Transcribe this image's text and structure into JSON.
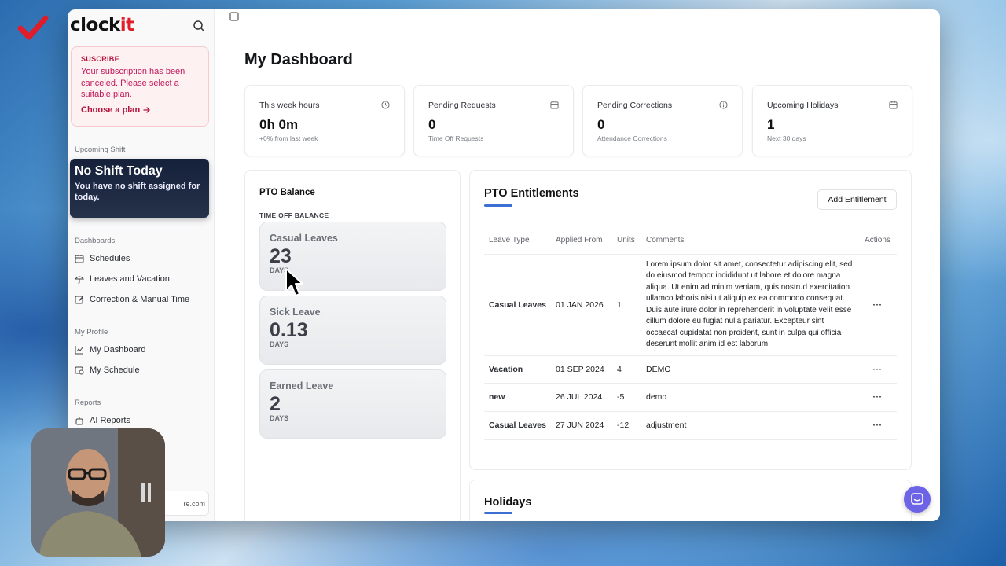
{
  "sidebar": {
    "logo_prefix": "clock",
    "logo_suffix": "it",
    "subscription": {
      "title": "SUSCRIBE",
      "message": "Your subscription has been canceled. Please select a suitable plan.",
      "link": "Choose a plan"
    },
    "upcoming_shift_label": "Upcoming Shift",
    "shift_title": "No Shift Today",
    "shift_message": "You have no shift assigned for today.",
    "section_dashboards": "Dashboards",
    "dashboards": [
      "Schedules",
      "Leaves and Vacation",
      "Correction & Manual Time"
    ],
    "section_profile": "My Profile",
    "profile": [
      "My Dashboard",
      "My Schedule"
    ],
    "section_reports": "Reports",
    "reports": [
      "AI Reports"
    ],
    "email_fragment": "re.com"
  },
  "main": {
    "title": "My Dashboard",
    "stats": [
      {
        "label": "This week hours",
        "value": "0h 0m",
        "sub": "+0% from last week",
        "icon": "clock-icon"
      },
      {
        "label": "Pending Requests",
        "value": "0",
        "sub": "Time Off Requests",
        "icon": "calendar-icon"
      },
      {
        "label": "Pending Corrections",
        "value": "0",
        "sub": "Attendance Corrections",
        "icon": "info-icon"
      },
      {
        "label": "Upcoming Holidays",
        "value": "1",
        "sub": "Next 30 days",
        "icon": "calendar-icon"
      }
    ],
    "pto": {
      "title": "PTO Balance",
      "subtitle": "TIME OFF BALANCE",
      "leaves": [
        {
          "name": "Casual Leaves",
          "value": "23",
          "unit": "DAYS"
        },
        {
          "name": "Sick Leave",
          "value": "0.13",
          "unit": "DAYS"
        },
        {
          "name": "Earned Leave",
          "value": "2",
          "unit": "DAYS"
        }
      ]
    },
    "entitlements": {
      "title": "PTO Entitlements",
      "add_button": "Add Entitlement",
      "columns": [
        "Leave Type",
        "Applied From",
        "Units",
        "Comments",
        "Actions"
      ],
      "rows": [
        {
          "type": "Casual Leaves",
          "from": "01 JAN 2026",
          "units": "1",
          "comments": "Lorem ipsum dolor sit amet, consectetur adipiscing elit, sed do eiusmod tempor incididunt ut labore et dolore magna aliqua. Ut enim ad minim veniam, quis nostrud exercitation ullamco laboris nisi ut aliquip ex ea commodo consequat. Duis aute irure dolor in reprehenderit in voluptate velit esse cillum dolore eu fugiat nulla pariatur. Excepteur sint occaecat cupidatat non proident, sunt in culpa qui officia deserunt mollit anim id est laborum.",
          "action": "···"
        },
        {
          "type": "Vacation",
          "from": "01 SEP 2024",
          "units": "4",
          "comments": "DEMO",
          "action": "···"
        },
        {
          "type": "new",
          "from": "26 JUL 2024",
          "units": "-5",
          "comments": "demo",
          "action": "···"
        },
        {
          "type": "Casual Leaves",
          "from": "27 JUN 2024",
          "units": "-12",
          "comments": "adjustment",
          "action": "···"
        }
      ]
    },
    "holidays_title": "Holidays"
  },
  "colors": {
    "accent": "#3b6fd1",
    "brand_red": "#e11d2a",
    "alert": "#b4123a",
    "chat": "#6d63e6"
  }
}
